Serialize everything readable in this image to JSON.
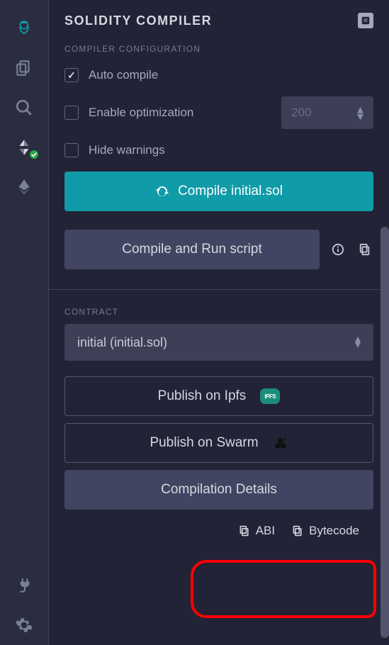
{
  "panel": {
    "title": "SOLIDITY COMPILER"
  },
  "config": {
    "section_label": "COMPILER CONFIGURATION",
    "auto_compile_label": "Auto compile",
    "enable_optimization_label": "Enable optimization",
    "optimization_runs": "200",
    "hide_warnings_label": "Hide warnings"
  },
  "actions": {
    "compile_label": "Compile initial.sol",
    "compile_run_label": "Compile and Run script"
  },
  "contract": {
    "section_label": "CONTRACT",
    "selected": "initial (initial.sol)",
    "publish_ipfs_label": "Publish on Ipfs",
    "publish_swarm_label": "Publish on Swarm",
    "details_label": "Compilation Details",
    "abi_label": "ABI",
    "bytecode_label": "Bytecode",
    "ipfs_badge": "IPFS"
  }
}
